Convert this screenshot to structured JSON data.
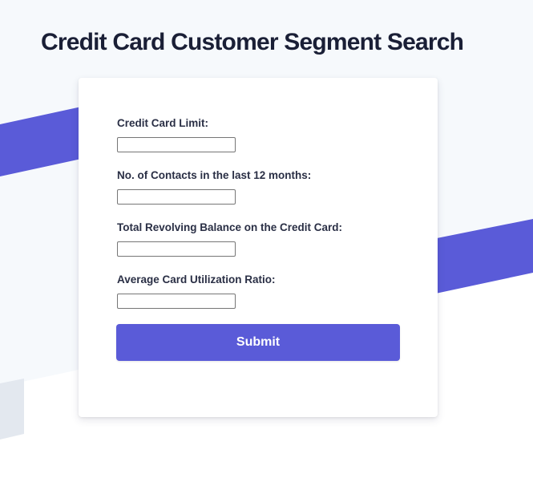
{
  "page": {
    "title": "Credit Card Customer Segment Search"
  },
  "form": {
    "fields": [
      {
        "label": "Credit Card Limit:",
        "value": ""
      },
      {
        "label": "No. of Contacts in the last 12 months:",
        "value": ""
      },
      {
        "label": "Total Revolving Balance on the Credit Card:",
        "value": ""
      },
      {
        "label": "Average Card Utilization Ratio:",
        "value": ""
      }
    ],
    "submit_label": "Submit"
  },
  "colors": {
    "accent": "#5a5bd8",
    "background_light": "#f6f9fc",
    "text": "#1a1f36"
  }
}
